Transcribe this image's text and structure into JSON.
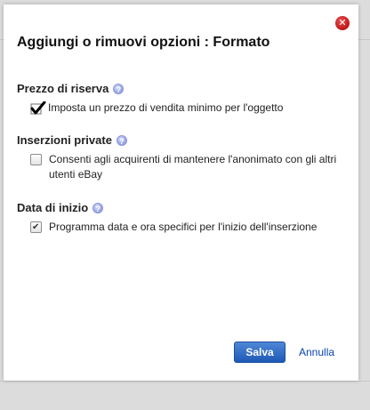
{
  "dialog": {
    "title": "Aggiungi o rimuovi opzioni : Formato",
    "close_icon": "close-icon"
  },
  "sections": [
    {
      "heading": "Prezzo di riserva",
      "help_icon": "help-icon",
      "option": {
        "label": "Imposta un prezzo di vendita minimo per l'oggetto",
        "checked": true
      }
    },
    {
      "heading": "Inserzioni private",
      "help_icon": "help-icon",
      "option": {
        "label": "Consenti agli acquirenti di mantenere l'anonimato con gli altri utenti eBay",
        "checked": false
      }
    },
    {
      "heading": "Data di inizio",
      "help_icon": "help-icon",
      "option": {
        "label": "Programma data e ora specifici per l'inizio dell'inserzione",
        "checked": true
      }
    }
  ],
  "footer": {
    "save_label": "Salva",
    "cancel_label": "Annulla"
  },
  "colors": {
    "save_button": "#2a64bf",
    "cancel_link": "#0645ad",
    "close_button": "#c01616"
  }
}
